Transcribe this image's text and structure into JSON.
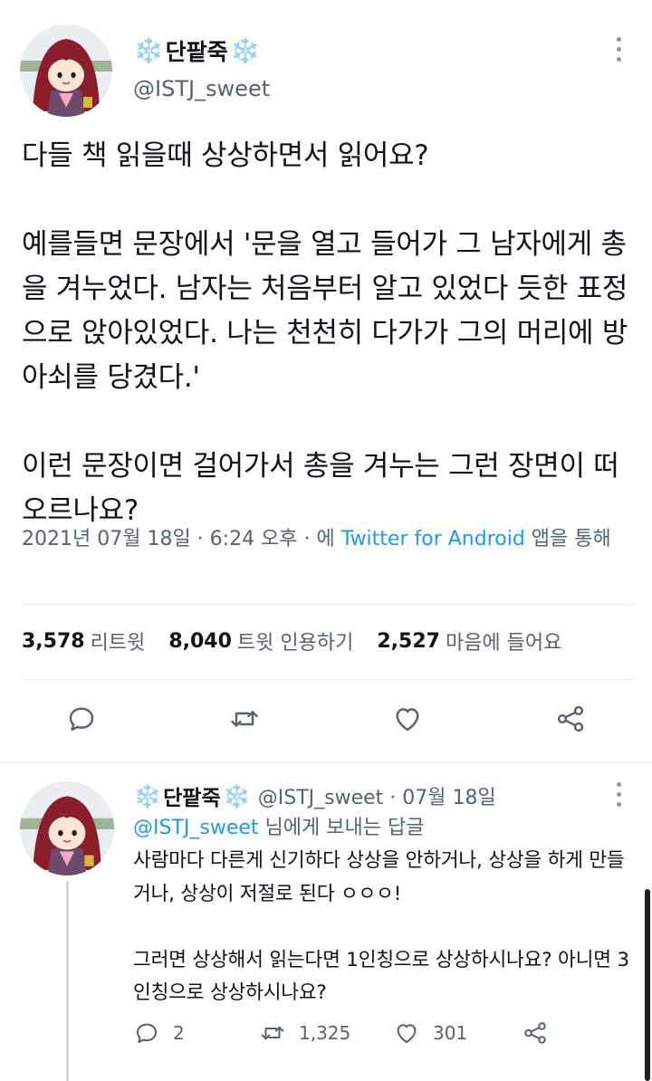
{
  "main_tweet": {
    "snow_left": "❄️",
    "display_name": "단팥죽",
    "snow_right": "❄️",
    "handle": "@ISTJ_sweet",
    "text": "다들 책 읽을때 상상하면서 읽어요?\n\n예를들면 문장에서 '문을 열고 들어가 그 남자에게 총을 겨누었다. 남자는 처음부터 알고 있었다 듯한 표정으로 앉아있었다. 나는 천천히 다가가 그의 머리에 방아쇠를 당겼다.'\n\n이런 문장이면 걸어가서 총을 겨누는 그런 장면이 떠오르나요?",
    "timestamp": "2021년 07월 18일 · 6:24 오후 · 에 ",
    "source": "Twitter for Android",
    "source_suffix": " 앱을 통해",
    "stats": {
      "retweets_count": "3,578",
      "retweets_label": "리트윗",
      "quotes_count": "8,040",
      "quotes_label": "트윗 인용하기",
      "likes_count": "2,527",
      "likes_label": "마음에 들어요"
    },
    "actions": [
      "reply-icon",
      "retweet-icon",
      "like-icon",
      "share-icon"
    ]
  },
  "reply": {
    "snow_left": "❄️",
    "display_name": "단팥죽",
    "snow_right": "❄️",
    "handle_date": "@ISTJ_sweet · 07월 18일",
    "replying_mention": "@ISTJ_sweet",
    "replying_suffix": " 님에게 보내는 답글",
    "text": "사람마다 다른게 신기하다 상상을 안하거나, 상상을 하게 만들거나, 상상이 저절로 된다 ㅇㅇㅇ!\n\n그러면 상상해서 읽는다면 1인칭으로 상상하시나요? 아니면 3인칭으로 상상하시나요?",
    "reply_count": "2",
    "retweet_count": "1,325",
    "like_count": "301"
  },
  "colors": {
    "link": "#1d9bf0",
    "secondary_text": "#536471",
    "snowflake": "#5aa6e6"
  }
}
